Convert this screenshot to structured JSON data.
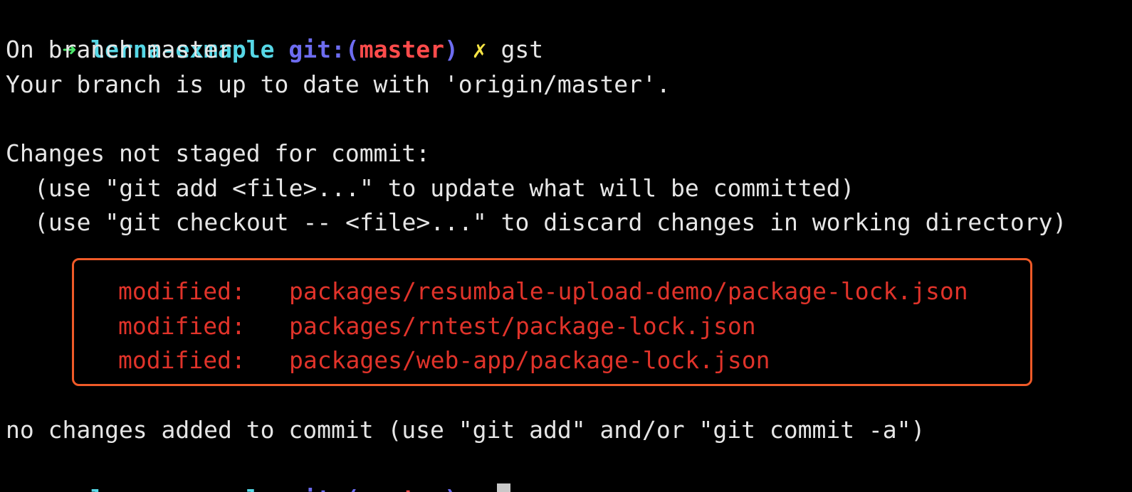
{
  "prompt": {
    "arrow_glyph": "➜",
    "directory": "lerna-exmaple",
    "git_label": "git:(",
    "branch": "master",
    "git_close": ")",
    "dirty_glyph": "✗"
  },
  "command": "gst",
  "output": {
    "branch_line": "On branch master",
    "upstream_line": "Your branch is up to date with 'origin/master'.",
    "not_staged_header": "Changes not staged for commit:",
    "hint_add": "(use \"git add <file>...\" to update what will be committed)",
    "hint_checkout": "(use \"git checkout -- <file>...\" to discard changes in working directory)",
    "modified_files": [
      {
        "status": "modified:",
        "path": "packages/resumbale-upload-demo/package-lock.json"
      },
      {
        "status": "modified:",
        "path": "packages/rntest/package-lock.json"
      },
      {
        "status": "modified:",
        "path": "packages/web-app/package-lock.json"
      }
    ],
    "footer": "no changes added to commit (use \"git add\" and/or \"git commit -a\")"
  },
  "colors": {
    "background": "#000000",
    "arrow": "#4ce66b",
    "directory": "#56d7e6",
    "git": "#6d6cf0",
    "branch": "#ff4b4b",
    "dirty": "#f7e544",
    "modified": "#e0332a",
    "highlight_border": "#f05a28"
  }
}
